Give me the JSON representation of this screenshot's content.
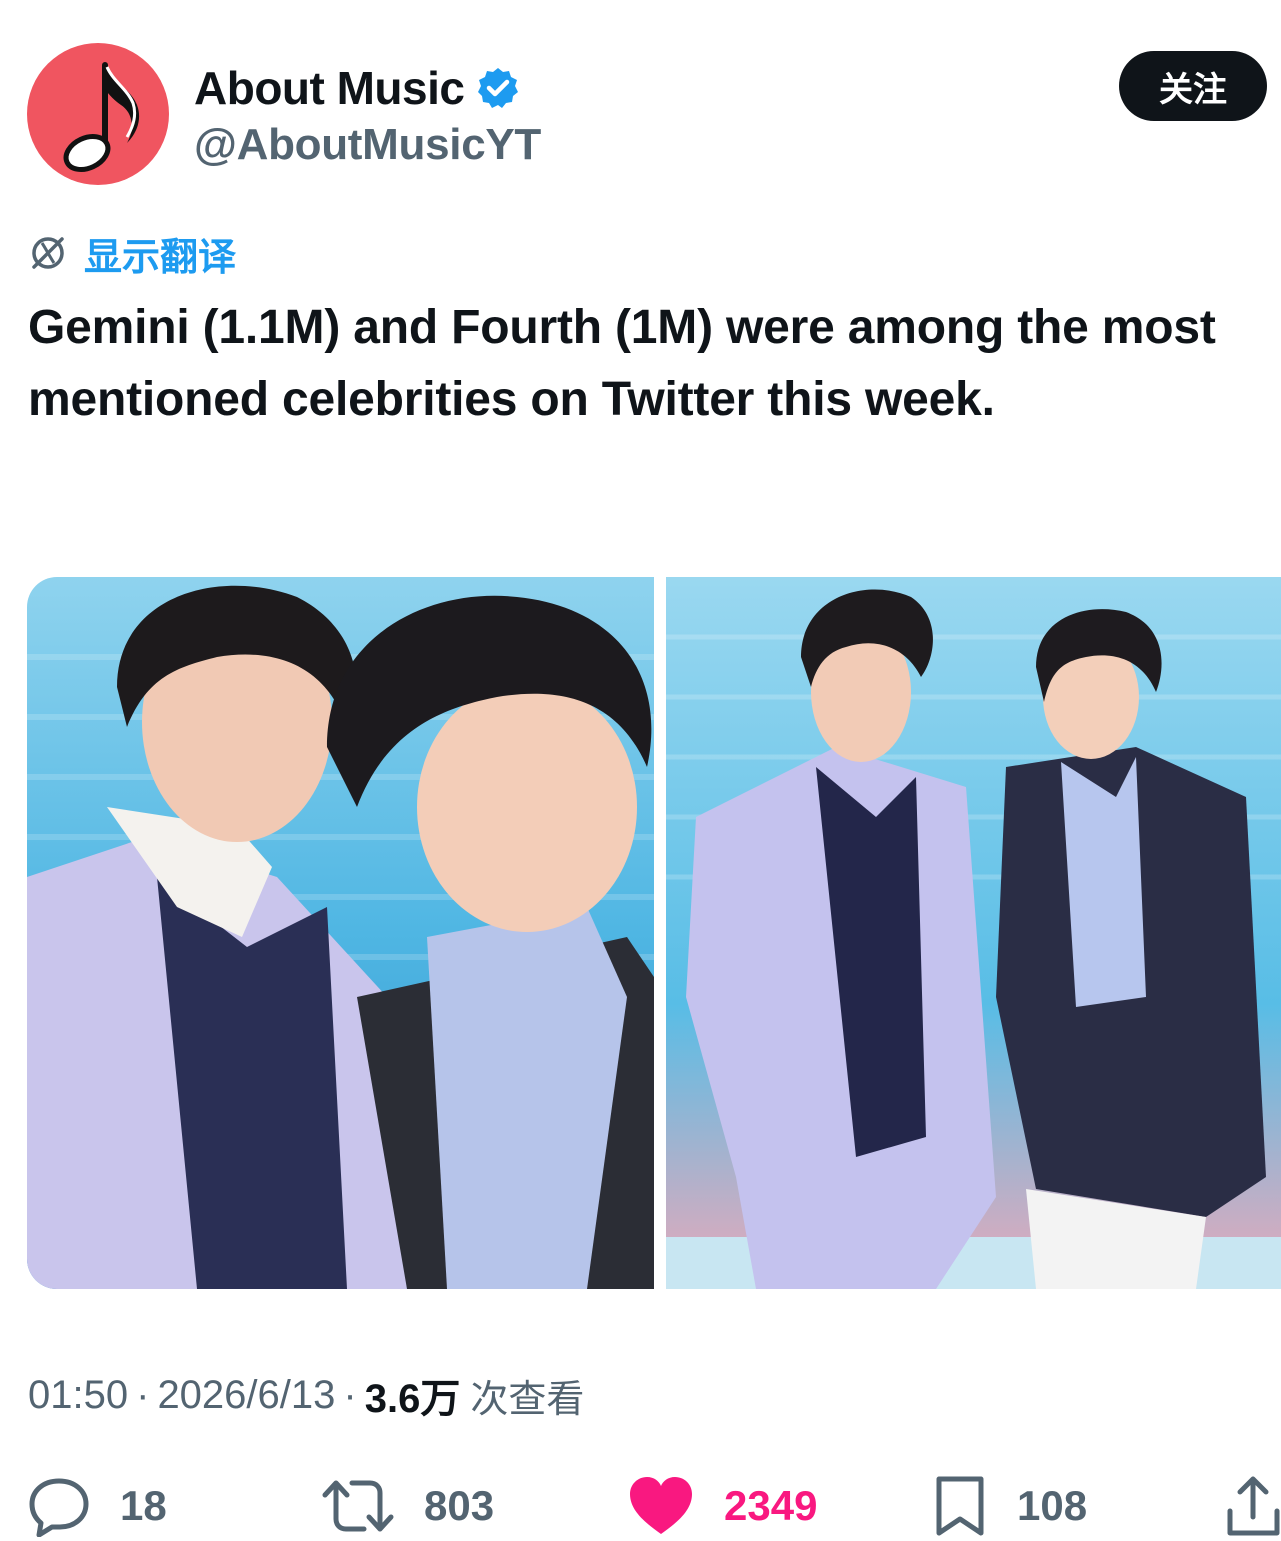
{
  "header": {
    "display_name": "About Music",
    "handle": "@AboutMusicYT",
    "follow_label": "关注",
    "avatar_icon": "music-note-icon",
    "verified_icon": "verified-badge-icon",
    "avatar_color": "#f05560",
    "verified_color": "#1d9bf0"
  },
  "translate": {
    "icon": "globe-icon",
    "label": "显示翻译",
    "color": "#1d9bf0"
  },
  "tweet": {
    "text": "Gemini (1.1M) and Fourth (1M) were among the most mentioned celebrities on Twitter this week."
  },
  "media": {
    "photos": [
      {
        "name": "photo-closeup"
      },
      {
        "name": "photo-full-length"
      }
    ]
  },
  "meta": {
    "time": "01:50",
    "separator": "·",
    "date": "2026/6/13",
    "views_count": "3.6万",
    "views_suffix": "次查看"
  },
  "actions": {
    "reply": {
      "icon": "reply-icon",
      "count": "18"
    },
    "retweet": {
      "icon": "retweet-icon",
      "count": "803"
    },
    "like": {
      "icon": "heart-icon",
      "count": "2349",
      "color": "#f91880"
    },
    "bookmark": {
      "icon": "bookmark-icon",
      "count": "108"
    },
    "share": {
      "icon": "share-icon"
    }
  }
}
